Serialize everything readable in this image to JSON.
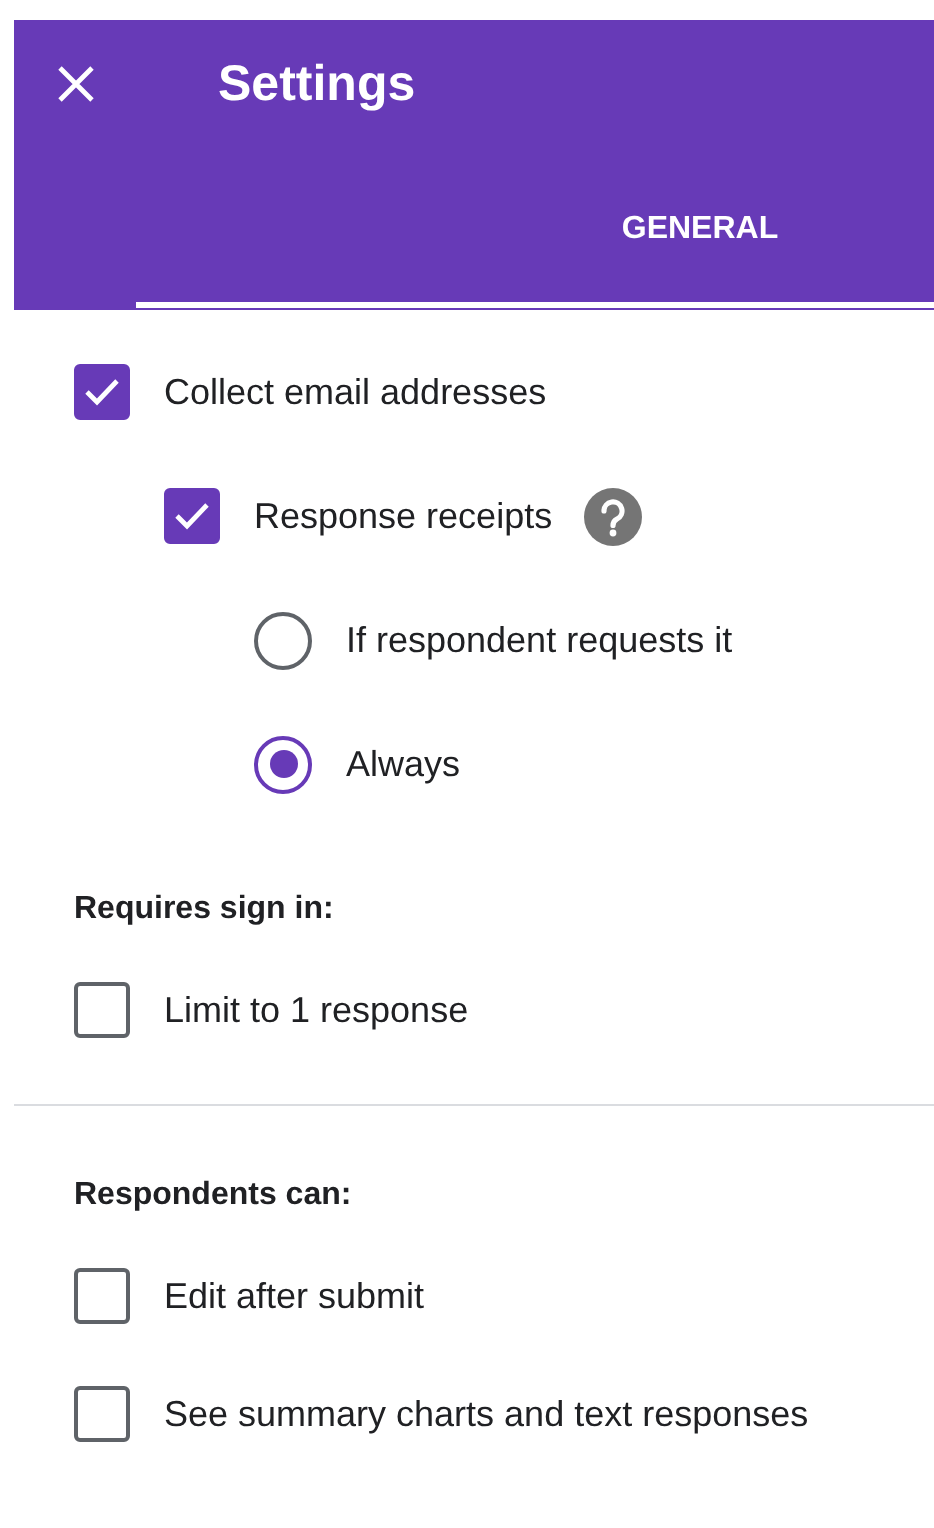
{
  "header": {
    "title": "Settings"
  },
  "tabs": [
    {
      "label": "GENERAL",
      "selected": true
    }
  ],
  "sections": [
    {
      "items": [
        {
          "kind": "checkbox",
          "label": "Collect email addresses",
          "checked": true,
          "children": [
            {
              "kind": "checkbox",
              "label": "Response receipts",
              "checked": true,
              "help": true,
              "children": [
                {
                  "kind": "radio",
                  "label": "If respondent requests it",
                  "selected": false
                },
                {
                  "kind": "radio",
                  "label": "Always",
                  "selected": true
                }
              ]
            }
          ]
        }
      ]
    },
    {
      "heading": "Requires sign in:",
      "items": [
        {
          "kind": "checkbox",
          "label": "Limit to 1 response",
          "checked": false
        }
      ]
    },
    {
      "divider_before": true,
      "heading": "Respondents can:",
      "items": [
        {
          "kind": "checkbox",
          "label": "Edit after submit",
          "checked": false
        },
        {
          "kind": "checkbox",
          "label": "See summary charts and text responses",
          "checked": false
        }
      ]
    }
  ]
}
